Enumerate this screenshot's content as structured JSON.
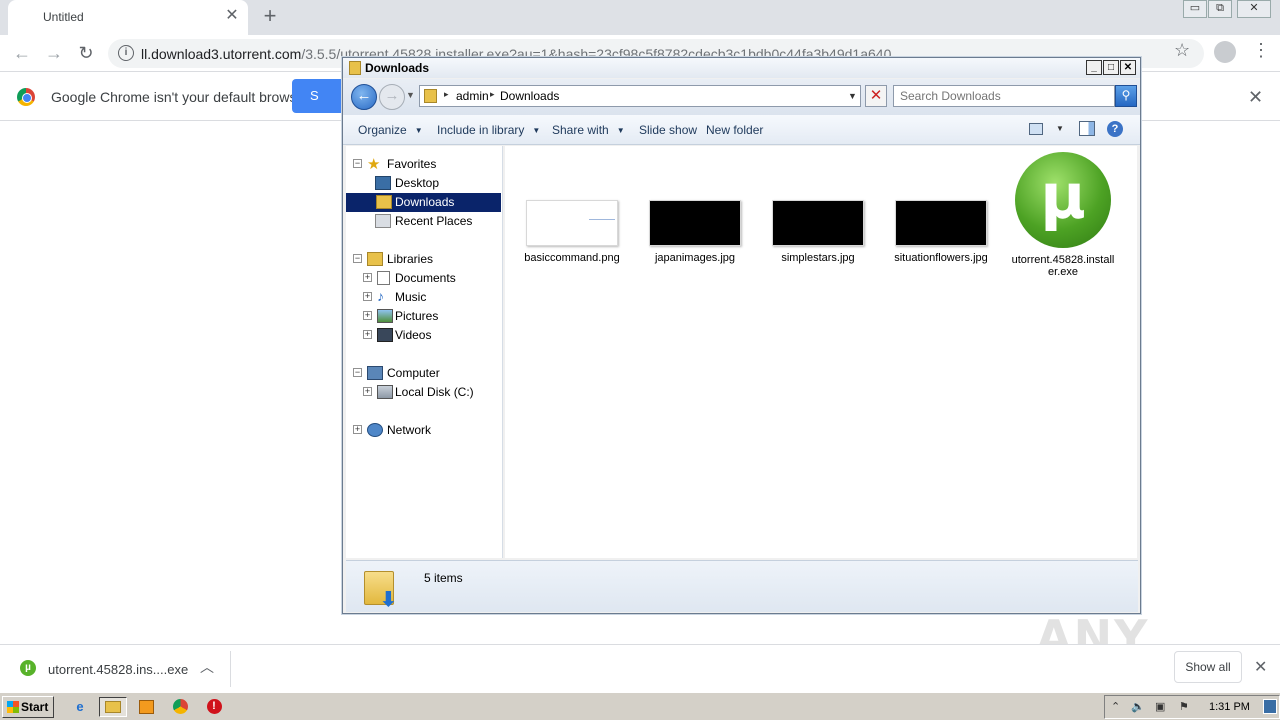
{
  "browser": {
    "tab_title": "Untitled",
    "tab_close": "✕",
    "new_tab": "+",
    "url_host": "ll.download3.utorrent.com",
    "url_path": "/3.5.5/utorrent.45828.installer.exe?au=1&hash=23cf98c5f8782cdecb3c1bdb0c44fa3b49d1a640",
    "infobar_text": "Google Chrome isn't your default browser",
    "infobar_button": "S",
    "infobar_close": "✕",
    "window_controls": [
      "▭",
      "⧉",
      "✕"
    ]
  },
  "explorer": {
    "title": "Downloads",
    "controls": [
      "_",
      "□",
      "✕"
    ],
    "breadcrumb": [
      "admin",
      "Downloads"
    ],
    "search_placeholder": "Search Downloads",
    "commands": {
      "organize": "Organize",
      "include_in_library": "Include in library",
      "share_with": "Share with",
      "slide_show": "Slide show",
      "new_folder": "New folder"
    },
    "nav": {
      "favorites": "Favorites",
      "desktop": "Desktop",
      "downloads": "Downloads",
      "recent_places": "Recent Places",
      "libraries": "Libraries",
      "documents": "Documents",
      "music": "Music",
      "pictures": "Pictures",
      "videos": "Videos",
      "computer": "Computer",
      "local_disk": "Local Disk (C:)",
      "network": "Network"
    },
    "files": [
      {
        "name": "basiccommand.png",
        "thumb": "white"
      },
      {
        "name": "japanimages.jpg",
        "thumb": "black"
      },
      {
        "name": "simplestars.jpg",
        "thumb": "black"
      },
      {
        "name": "situationflowers.jpg",
        "thumb": "black"
      },
      {
        "name": "utorrent.45828.installer.exe",
        "thumb": "utorrent-logo"
      }
    ],
    "status": "5 items"
  },
  "downloads_shelf": {
    "item_name": "utorrent.45828.ins....exe",
    "show_all": "Show all",
    "close": "✕"
  },
  "watermark": "ANY RUN",
  "taskbar": {
    "start": "Start",
    "clock": "1:31 PM"
  },
  "colors": {
    "chrome_blue": "#4285f4",
    "nav_selected": "#0a246a",
    "utorrent_green": "#4da224",
    "taskbar": "#d4d0c8"
  }
}
